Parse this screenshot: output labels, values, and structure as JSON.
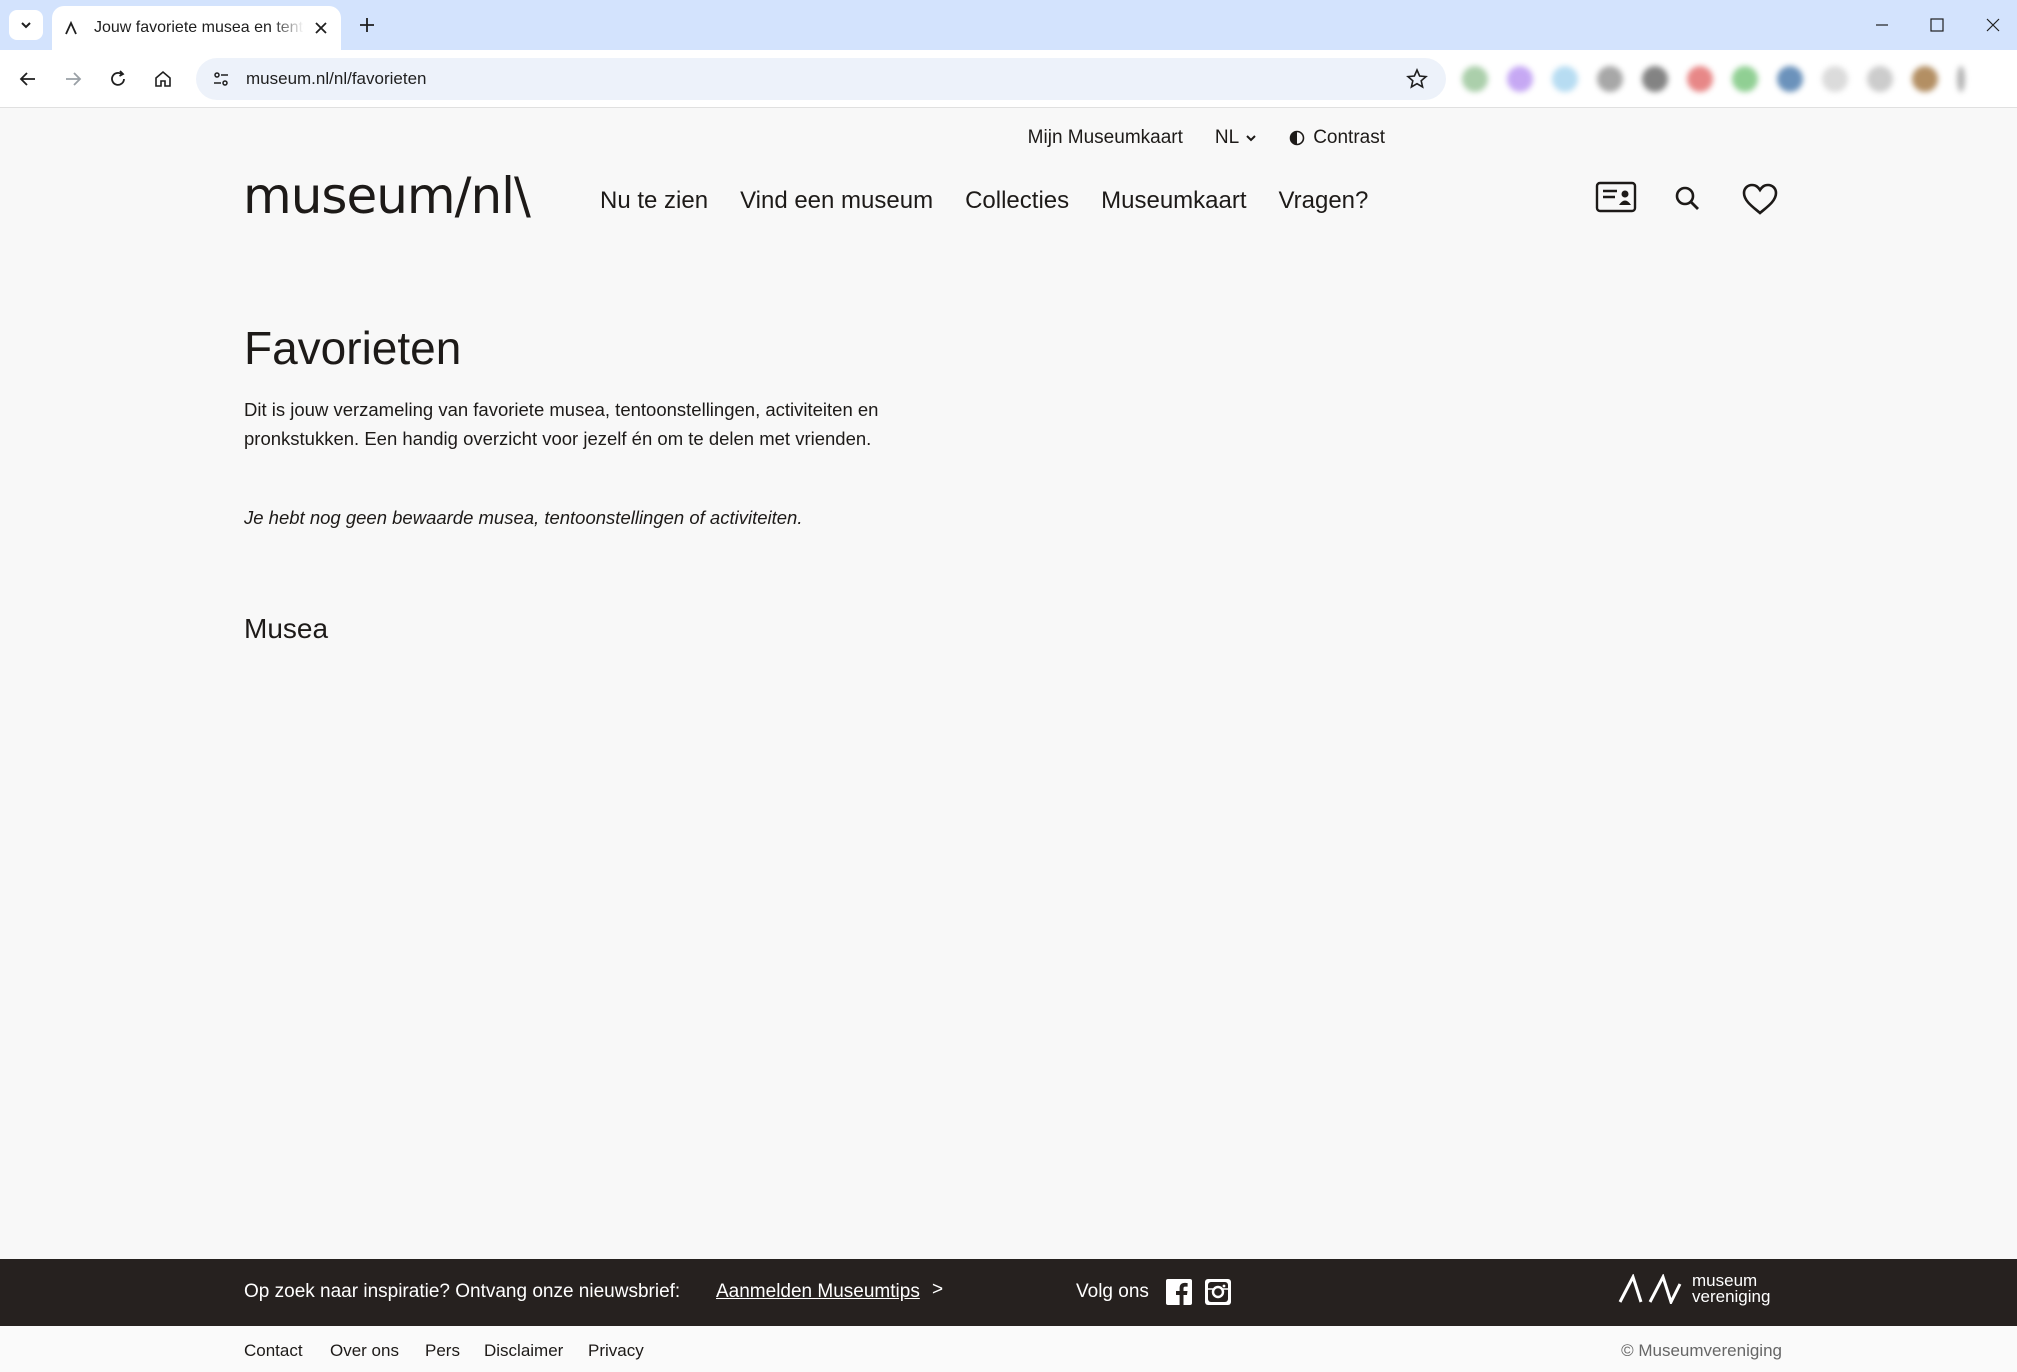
{
  "browser": {
    "tab_title": "Jouw favoriete musea en tentoonstellingen",
    "url": "museum.nl/nl/favorieten"
  },
  "utility": {
    "my_card": "Mijn Museumkaart",
    "language": "NL",
    "contrast": "Contrast"
  },
  "header": {
    "logo": "museum/nl\\",
    "nav": [
      "Nu te zien",
      "Vind een museum",
      "Collecties",
      "Museumkaart",
      "Vragen?"
    ]
  },
  "main": {
    "title": "Favorieten",
    "intro": "Dit is jouw verzameling van favoriete musea, tentoonstellingen, activiteiten en pronkstukken. Een handig overzicht voor jezelf én om te delen met vrienden.",
    "empty_note": "Je hebt nog geen bewaarde musea, tentoonstellingen of activiteiten.",
    "section_title": "Musea"
  },
  "footer": {
    "newsletter_text": "Op zoek naar inspiratie? Ontvang onze nieuwsbrief:",
    "newsletter_link": "Aanmelden Museumtips",
    "newsletter_arrow": ">",
    "follow": "Volg ons",
    "org_logo_line1": "museum",
    "org_logo_line2": "vereniging",
    "links": [
      "Contact",
      "Over ons",
      "Pers",
      "Disclaimer",
      "Privacy"
    ],
    "copyright": "© Museumvereniging"
  },
  "colors": {
    "tabbar": "#d3e3fd",
    "page_bg": "#f8f8f8",
    "footer_bg": "#26211f",
    "text": "#1d1a18"
  }
}
